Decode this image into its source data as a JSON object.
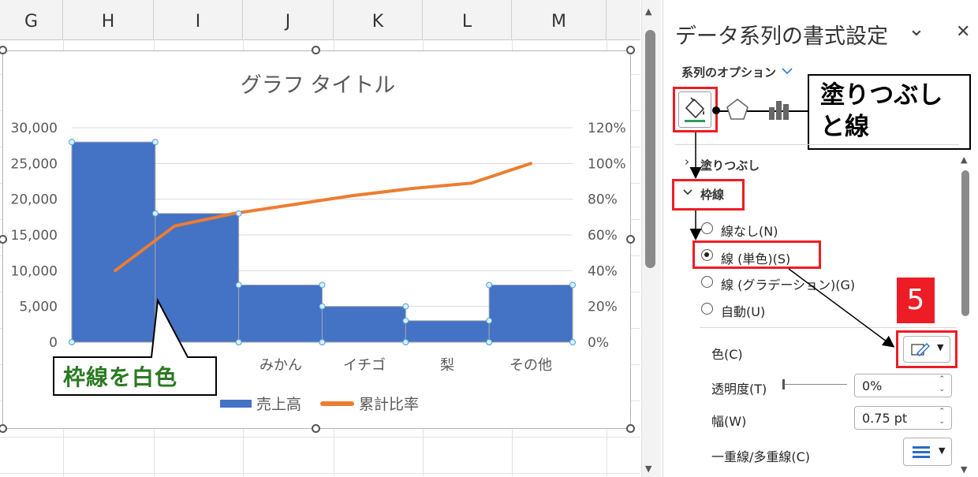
{
  "spreadsheet": {
    "columns": [
      "G",
      "H",
      "I",
      "J",
      "K",
      "L",
      "M"
    ]
  },
  "chart_data": {
    "type": "bar",
    "title": "グラフ タイトル",
    "categories": [
      "",
      "",
      "",
      "みかん",
      "イチゴ",
      "梨",
      "その他"
    ],
    "series": [
      {
        "name": "売上高",
        "type": "bar",
        "axis": "left",
        "values": [
          28000,
          18000,
          8000,
          5000,
          3000,
          8000
        ]
      },
      {
        "name": "累計比率",
        "type": "line",
        "axis": "right",
        "values": [
          40,
          65,
          72,
          77,
          82,
          86,
          89,
          100
        ]
      }
    ],
    "left_axis": {
      "ticks": [
        "30,000",
        "25,000",
        "20,000",
        "15,000",
        "10,000",
        "5,000",
        "0"
      ],
      "ylim": [
        0,
        30000
      ]
    },
    "right_axis": {
      "ticks": [
        "120%",
        "100%",
        "80%",
        "60%",
        "40%",
        "20%",
        "0%"
      ],
      "ylim": [
        0,
        120
      ]
    },
    "legend": [
      "売上高",
      "累計比率"
    ],
    "legend_position": "bottom",
    "grid": true,
    "colors": {
      "bar": "#4472c4",
      "line": "#ed7d31"
    }
  },
  "callouts": {
    "white_border": "枠線を白色",
    "fill_line": "塗りつぶし\nと線",
    "step": "5"
  },
  "pane": {
    "title": "データ系列の書式設定",
    "close_glyph": "✕",
    "dropdown_glyph": "⌄",
    "series_options": "系列のオプション",
    "section_fill": "塗りつぶし",
    "section_border": "枠線",
    "radio_none": "線なし(N)",
    "radio_solid": "線 (単色)(S)",
    "radio_gradient": "線 (グラデーション)(G)",
    "radio_auto": "自動(U)",
    "selected_radio": "radio_solid",
    "color_label": "色(C)",
    "transparency_label": "透明度(T)",
    "transparency_value": "0%",
    "transparency_level": 0,
    "width_label": "幅(W)",
    "width_value": "0.75 pt",
    "compound_label": "一重線/多重線(C)"
  }
}
